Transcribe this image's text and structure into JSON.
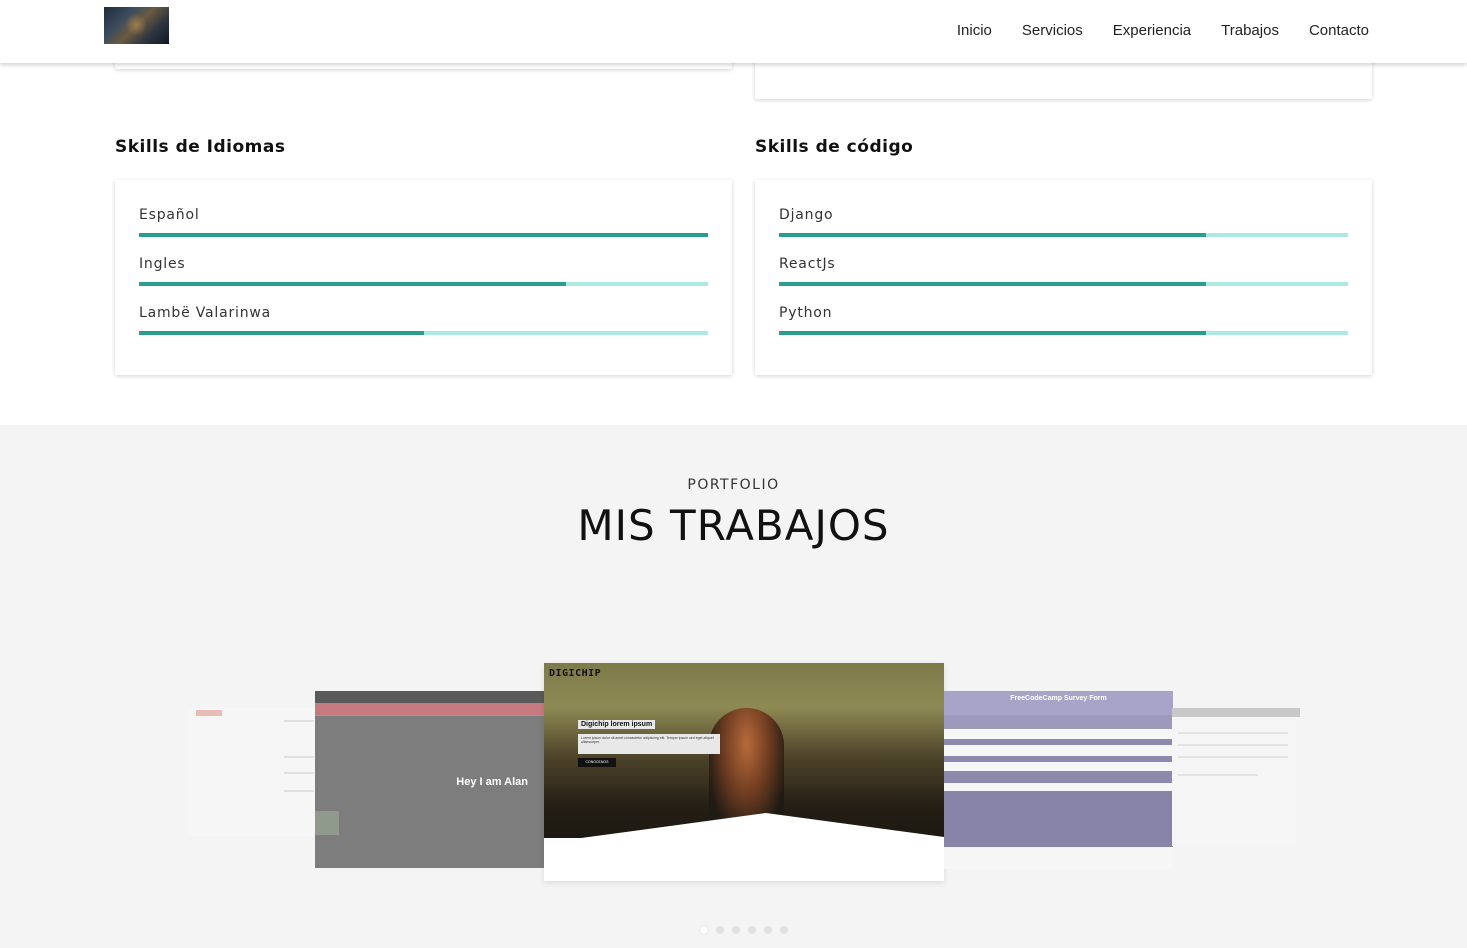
{
  "nav": {
    "items": [
      "Inicio",
      "Servicios",
      "Experiencia",
      "Trabajos",
      "Contacto"
    ]
  },
  "language_skills": {
    "title": "Skills de Idiomas",
    "items": [
      {
        "label": "Español",
        "level": 1.0
      },
      {
        "label": "Ingles",
        "level": 0.75
      },
      {
        "label": "Lambë Valarinwa",
        "level": 0.5
      }
    ]
  },
  "code_skills": {
    "title": "Skills de código",
    "items": [
      {
        "label": "Django",
        "level": 0.75
      },
      {
        "label": "ReactJs",
        "level": 0.75
      },
      {
        "label": "Python",
        "level": 0.75
      }
    ]
  },
  "portfolio": {
    "subtitle": "PORTFOLIO",
    "title": "MIS TRABAJOS",
    "slides": {
      "left": {
        "headline": "Hey I am Alan"
      },
      "center": {
        "brand": "DIGICHIP",
        "heading": "Digichip lorem ipsum",
        "body": "Lorem ipsum dolor sit amet consectetur adipiscing elit. Tempor ipsum sed eget aliquet ullamcorper.",
        "button": "CONOCENOS"
      },
      "right": {
        "title": "FreeCodeCamp Survey Form"
      }
    },
    "dots": 6,
    "active_dot": 0
  },
  "colors": {
    "bar_fill": "#2a9d8f",
    "bar_track": "#aee8e2"
  }
}
